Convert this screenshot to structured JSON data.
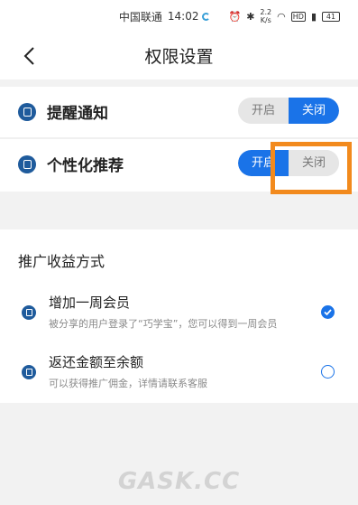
{
  "status_bar": {
    "carrier": "中国联通",
    "time": "14:02",
    "speed_value": "2.2",
    "speed_unit": "K/s",
    "battery": "41"
  },
  "header": {
    "title": "权限设置"
  },
  "permissions": [
    {
      "label": "提醒通知",
      "on_label": "开启",
      "off_label": "关闭",
      "state": "off"
    },
    {
      "label": "个性化推荐",
      "on_label": "开启",
      "off_label": "关闭",
      "state": "on"
    }
  ],
  "promo": {
    "title": "推广收益方式",
    "options": [
      {
        "title": "增加一周会员",
        "description": "被分享的用户登录了“巧学宝”，您可以得到一周会员",
        "selected": true
      },
      {
        "title": "返还金额至余额",
        "description": "可以获得推广佣金，详情请联系客服",
        "selected": false
      }
    ]
  },
  "watermark": "GASK.CC",
  "colors": {
    "accent": "#1a73e8",
    "icon": "#1f5b9c",
    "highlight": "#f28a1d"
  }
}
